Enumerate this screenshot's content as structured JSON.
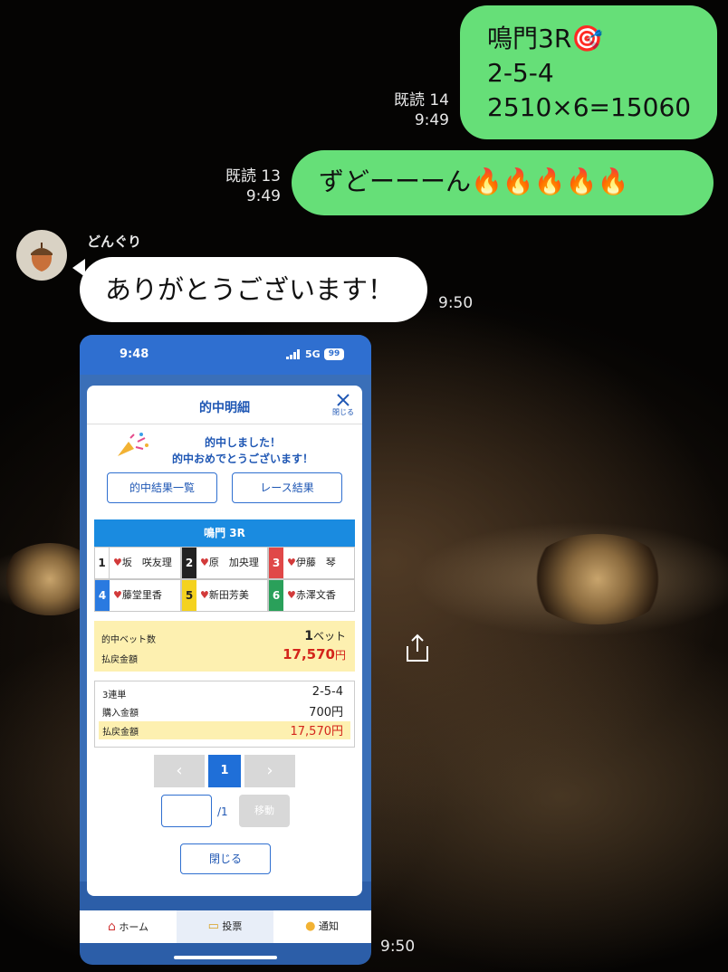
{
  "messages": {
    "sent1": {
      "lines": [
        "鳴門3R🎯",
        "2-5-4",
        "2510×6=15060"
      ],
      "read": "既読 14",
      "time": "9:49"
    },
    "sent2": {
      "text": "ずどーーーん🔥🔥🔥🔥🔥",
      "read": "既読 13",
      "time": "9:49"
    },
    "received1": {
      "sender": "どんぐり",
      "text": "ありがとうございます！",
      "time": "9:50"
    },
    "received_image": {
      "time": "9:50"
    }
  },
  "phone": {
    "status_time": "9:48",
    "network": "5G",
    "battery": "99",
    "modal": {
      "title": "的中明細",
      "close_x_label": "閉じる",
      "congrats1": "的中しました！",
      "congrats2": "的中おめでとうございます！",
      "btn_results_list": "的中結果一覧",
      "btn_race_results": "レース結果",
      "race_header": "鳴門 3R",
      "racers": [
        {
          "num": "1",
          "name": "坂　咲友理"
        },
        {
          "num": "2",
          "name": "原　加央理"
        },
        {
          "num": "3",
          "name": "伊藤　琴"
        },
        {
          "num": "4",
          "name": "藤堂里香"
        },
        {
          "num": "5",
          "name": "新田芳美"
        },
        {
          "num": "6",
          "name": "赤澤文香"
        }
      ],
      "summary": {
        "bets_label": "的中ベット数",
        "bets_value": "1",
        "bets_unit": "ベット",
        "payout_label": "払戻金額",
        "payout_value": "17,570",
        "payout_unit": "円"
      },
      "detail": {
        "type_label": "3連単",
        "type_value": "2-5-4",
        "purchase_label": "購入金額",
        "purchase_value": "700円",
        "payout_label": "払戻金額",
        "payout_value": "17,570円"
      },
      "pager": {
        "prev": "‹",
        "current": "1",
        "next": "›",
        "input_value": "",
        "total": "/1",
        "go_label": "移動"
      },
      "close_button": "閉じる"
    },
    "tabbar": {
      "home": "ホーム",
      "bet": "投票",
      "notify": "通知"
    }
  },
  "colors": {
    "line_green": "#66df78",
    "app_blue": "#2f6fd0",
    "payout_red": "#d4251b",
    "summary_yellow": "#fdf0b0"
  },
  "icons": [
    "dart-target-icon",
    "fire-icon",
    "acorn-avatar-icon",
    "share-icon",
    "close-icon",
    "party-popper-icon",
    "heart-icon",
    "home-icon",
    "ticket-icon",
    "bell-icon",
    "signal-icon",
    "battery-icon"
  ]
}
